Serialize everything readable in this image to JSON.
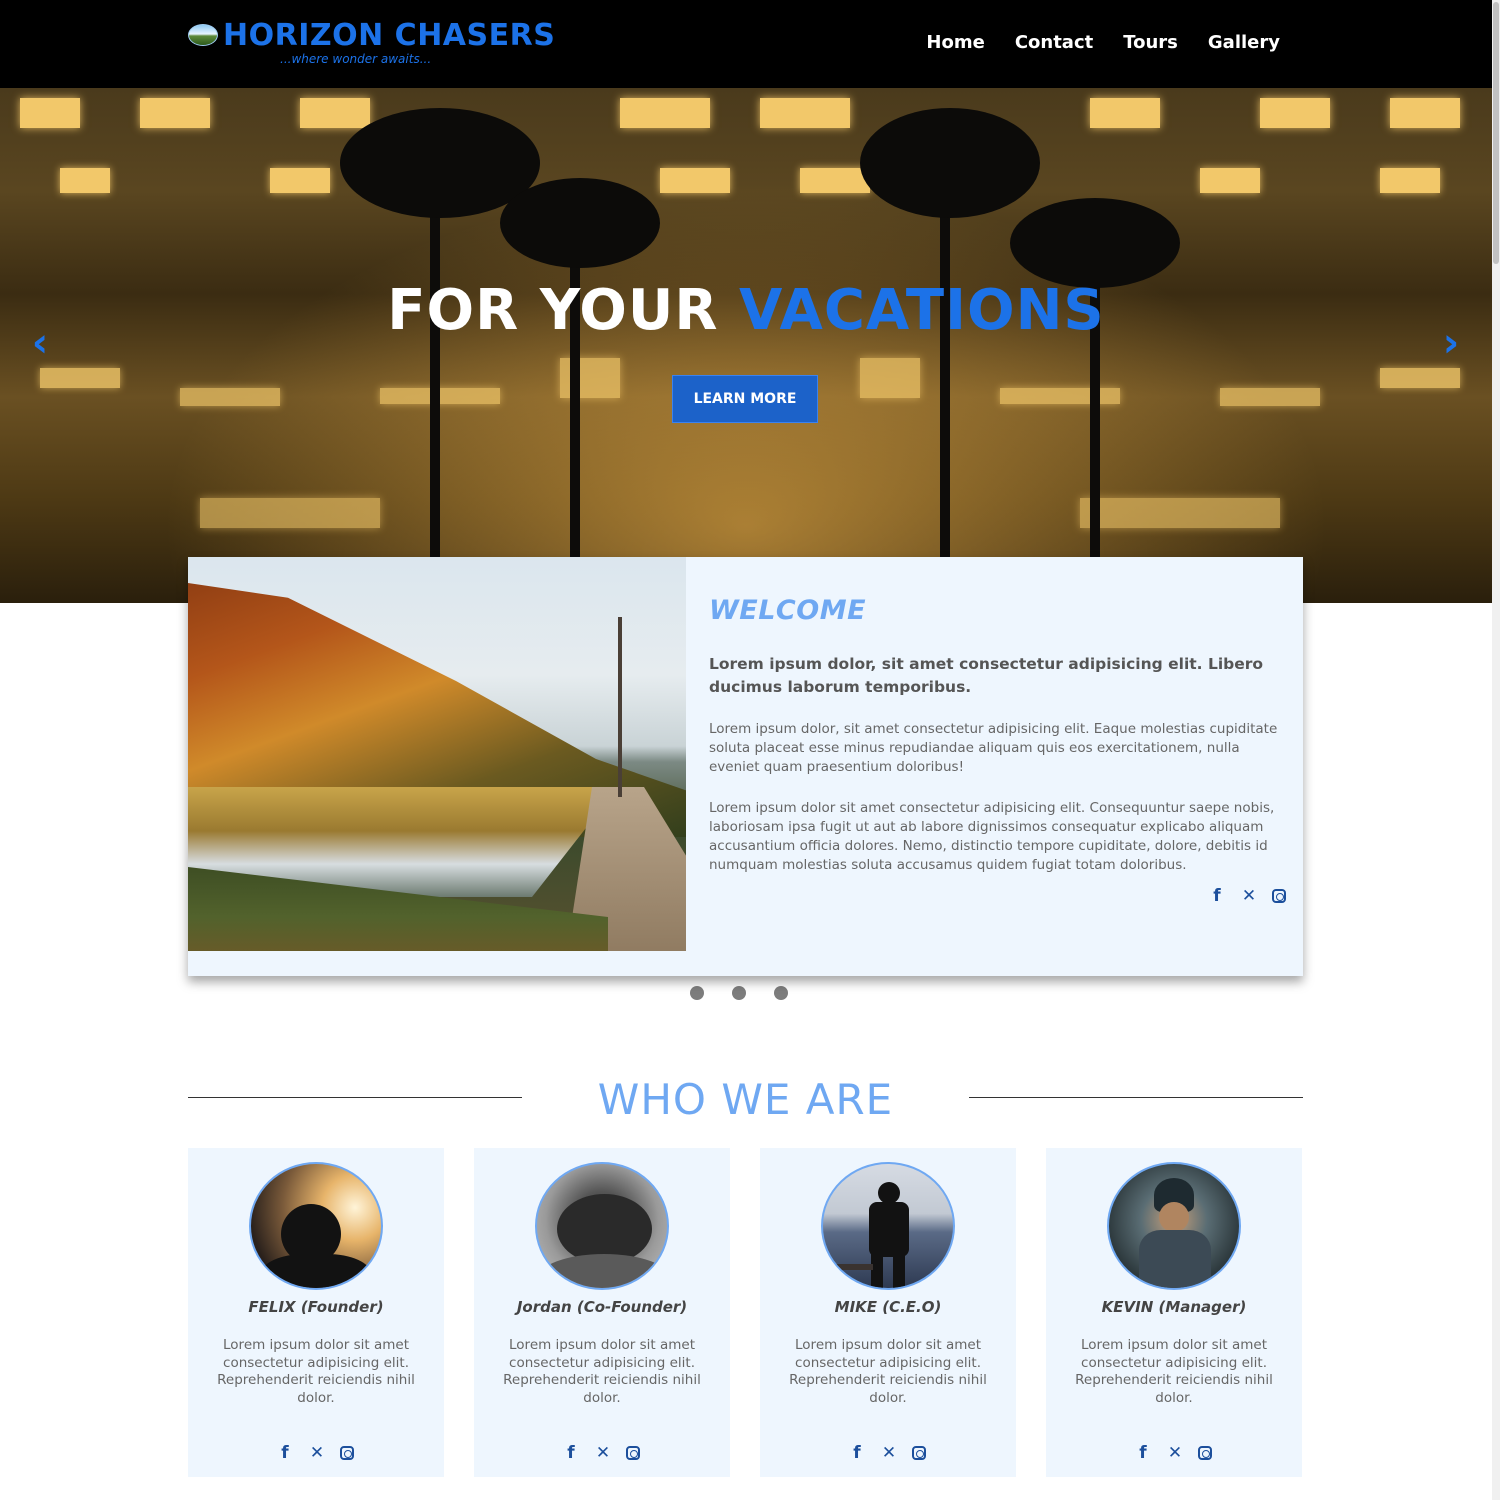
{
  "header": {
    "logo_title": "HORIZON CHASERS",
    "logo_tagline": "...where wonder awaits...",
    "nav": [
      "Home",
      "Contact",
      "Tours",
      "Gallery"
    ]
  },
  "hero": {
    "title_part1": "FOR YOUR ",
    "title_accent": "VACATIONS",
    "button_label": "LEARN MORE",
    "prev_arrow": "‹",
    "next_arrow": "›"
  },
  "welcome": {
    "title": "WELCOME",
    "lead": "Lorem ipsum dolor, sit amet consectetur adipisicing elit. Libero ducimus laborum temporibus.",
    "paragraph1": "Lorem ipsum dolor, sit amet consectetur adipisicing elit. Eaque molestias cupiditate soluta placeat esse minus repudiandae aliquam quis eos exercitationem, nulla eveniet quam praesentium doloribus!",
    "paragraph2": "Lorem ipsum dolor sit amet consectetur adipisicing elit. Consequuntur saepe nobis, laboriosam ipsa fugit ut aut ab labore dignissimos consequatur explicabo aliquam accusantium officia dolores. Nemo, distinctio tempore cupiditate, dolore, debitis id numquam molestias soluta accusamus quidem fugiat totam doloribus.",
    "social": [
      "facebook-icon",
      "x-icon",
      "instagram-icon"
    ]
  },
  "carousel": {
    "dot_count": 3
  },
  "who_we_are": {
    "title": "WHO WE ARE",
    "members": [
      {
        "name": "FELIX (Founder)",
        "description": "Lorem ipsum dolor sit amet consectetur adipisicing elit. Reprehenderit reiciendis nihil dolor."
      },
      {
        "name": "Jordan (Co-Founder)",
        "description": "Lorem ipsum dolor sit amet consectetur adipisicing elit. Reprehenderit reiciendis nihil dolor."
      },
      {
        "name": "MIKE (C.E.O)",
        "description": "Lorem ipsum dolor sit amet consectetur adipisicing elit. Reprehenderit reiciendis nihil dolor."
      },
      {
        "name": "KEVIN (Manager)",
        "description": "Lorem ipsum dolor sit amet consectetur adipisicing elit. Reprehenderit reiciendis nihil dolor."
      }
    ]
  },
  "colors": {
    "accent": "#1c72e8",
    "light_accent": "#6fa8f2",
    "card_bg": "#eef6fe",
    "icon": "#1c4f9c"
  }
}
